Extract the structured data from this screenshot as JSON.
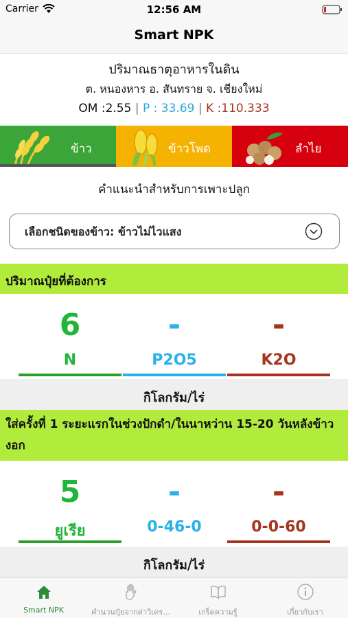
{
  "status": {
    "carrier": "Carrier",
    "time": "12:56 AM"
  },
  "nav": {
    "title": "Smart NPK"
  },
  "soil": {
    "title": "ปริมาณธาตุอาหารในดิน",
    "location": "ต. หนองหาร อ. สันทราย จ. เชียงใหม่",
    "om_label": "OM :2.55",
    "p_label": "P : 33.69",
    "k_label": "K :110.333",
    "separator": "|"
  },
  "crops": [
    {
      "label": "ข้าว",
      "icon": "rice-icon",
      "color": "#3ba53a"
    },
    {
      "label": "ข้าวโพด",
      "icon": "corn-icon",
      "color": "#f5b200"
    },
    {
      "label": "ลำไย",
      "icon": "longan-icon",
      "color": "#d7000f"
    }
  ],
  "recommendation": {
    "title": "คำแนะนำสำหรับการเพาะปลูก"
  },
  "select": {
    "value": "เลือกชนิดของข้าว: ข้าวไม่ไวแสง"
  },
  "fertilizer_needed": {
    "heading": "ปริมาณปุ๋ยที่ต้องการ",
    "n_value": "6",
    "p_value": "-",
    "k_value": "-",
    "n_label": "N",
    "p_label": "P2O5",
    "k_label": "K2O",
    "unit": "กิโลกรัม/ไร่"
  },
  "first_application": {
    "heading": "ใส่ครั้งที่ 1  ระยะแรกในช่วงปักดำ/ในนาหว่าน 15-20 วันหลังข้าวงอก",
    "v1": "5",
    "v2": "-",
    "v3": "-",
    "l1": "ยูเรีย",
    "l2": "0-46-0",
    "l3": "0-0-60",
    "unit": "กิโลกรัม/ไร่"
  },
  "tabs": [
    {
      "label": "Smart NPK",
      "icon": "home-icon"
    },
    {
      "label": "คำนวนปุ๋ยจากค่าวิเคร...",
      "icon": "hand-icon"
    },
    {
      "label": "เกร็ดความรู้",
      "icon": "book-icon"
    },
    {
      "label": "เกี่ยวกับเรา",
      "icon": "info-icon"
    }
  ],
  "colors": {
    "green_band": "#b1ec3c",
    "nitrogen": "#1fb53a",
    "phosphorus": "#29b2ea",
    "potassium": "#a7341f"
  }
}
